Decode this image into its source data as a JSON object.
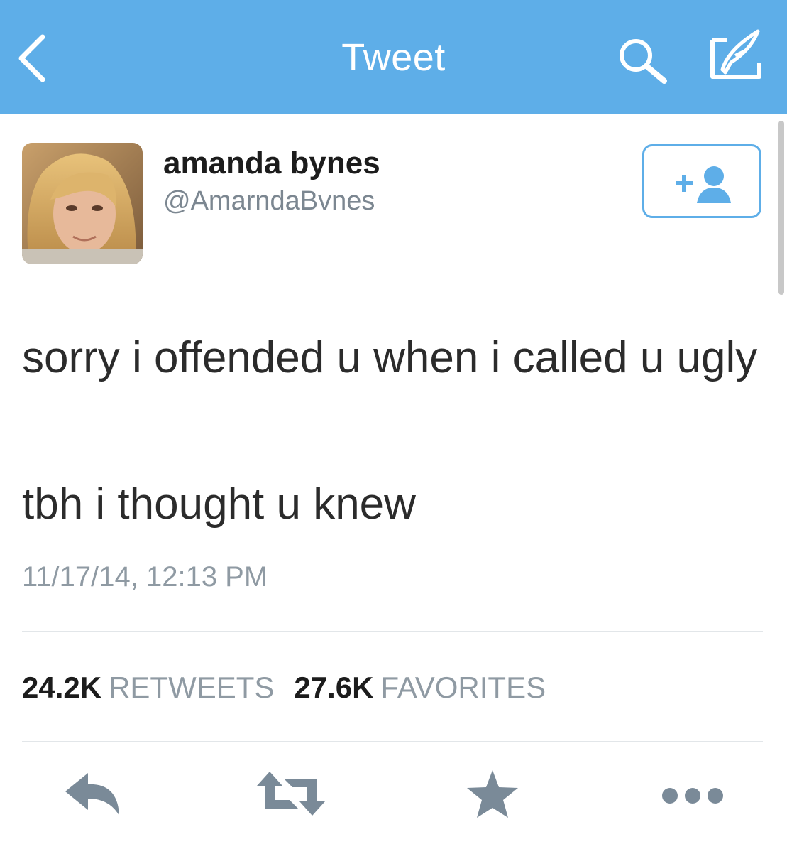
{
  "colors": {
    "brand": "#5eaee8",
    "text": "#2b2b2b",
    "muted": "#8f9aa3",
    "icon": "#7a8a98"
  },
  "navbar": {
    "title": "Tweet",
    "back_icon": "chevron-left-icon",
    "search_icon": "search-icon",
    "compose_icon": "compose-icon"
  },
  "author": {
    "display_name": "amanda bynes",
    "handle": "@AmarndaBvnes",
    "follow_icon": "add-user-icon"
  },
  "tweet": {
    "line1": "sorry i offended u when i called u ugly",
    "line2": "tbh i thought u knew",
    "timestamp": "11/17/14, 12:13 PM"
  },
  "stats": {
    "retweets_count": "24.2K",
    "retweets_label": "RETWEETS",
    "favorites_count": "27.6K",
    "favorites_label": "FAVORITES"
  },
  "actions": [
    "reply-icon",
    "retweet-icon",
    "favorite-star-icon",
    "more-icon"
  ]
}
